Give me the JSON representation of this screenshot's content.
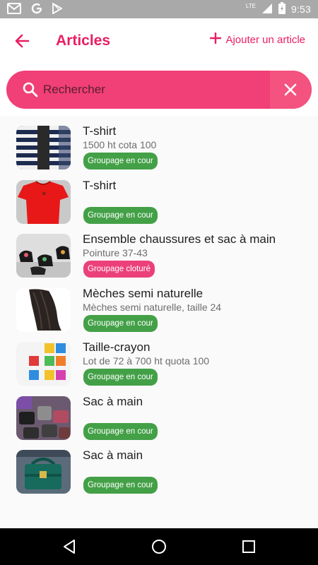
{
  "status_bar": {
    "time": "9:53",
    "network": "LTE",
    "left_icons": [
      "gmail-icon",
      "google-icon",
      "play-store-icon"
    ],
    "right_icons": [
      "signal-icon",
      "battery-icon"
    ]
  },
  "app_bar": {
    "title": "Articles",
    "add_label": "Ajouter un article",
    "accent": "#e91e63"
  },
  "search": {
    "placeholder": "Rechercher",
    "value": "",
    "bar_color": "#f13f77"
  },
  "articles": [
    {
      "title": "T-shirt",
      "subtitle": "1500 ht cota 100",
      "status": "Groupage en cour",
      "status_color": "#43a047",
      "thumb": "striped-tshirt-photo"
    },
    {
      "title": "T-shirt",
      "subtitle": "",
      "status": "Groupage en cour",
      "status_color": "#43a047",
      "thumb": "red-tshirt-photo"
    },
    {
      "title": "Ensemble chaussures et sac à main",
      "subtitle": "Pointure 37-43",
      "status": "Groupage cloturé",
      "status_color": "#ec407a",
      "thumb": "shoes-bag-photo"
    },
    {
      "title": "Mèches semi naturelle",
      "subtitle": "Mèches semi naturelle, taille 24",
      "status": "Groupage en cour",
      "status_color": "#43a047",
      "thumb": "hair-extension-photo"
    },
    {
      "title": "Taille-crayon",
      "subtitle": "Lot de 72 à 700 ht quota 100",
      "status": "Groupage en cour",
      "status_color": "#43a047",
      "thumb": "pencil-sharpener-photo"
    },
    {
      "title": "Sac à main",
      "subtitle": "",
      "status": "Groupage en cour",
      "status_color": "#43a047",
      "thumb": "handbags-photo"
    },
    {
      "title": "Sac à main",
      "subtitle": "",
      "status": "Groupage en cour",
      "status_color": "#43a047",
      "thumb": "green-handbag-photo"
    }
  ],
  "nav_bar": {
    "buttons": [
      "back-nav-icon",
      "home-nav-icon",
      "recents-nav-icon"
    ]
  }
}
